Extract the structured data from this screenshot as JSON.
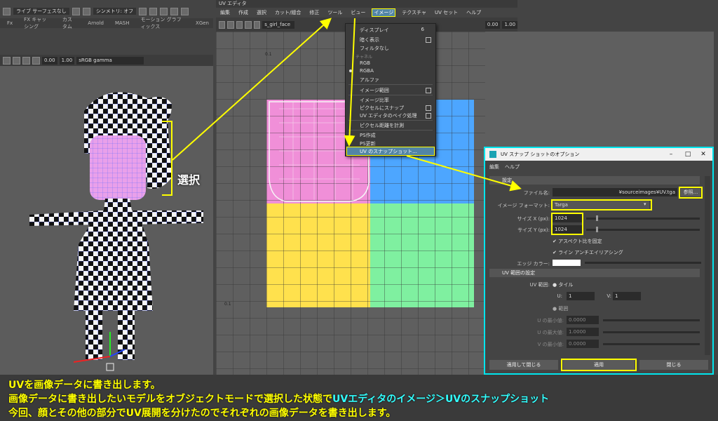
{
  "left_toolbar": {
    "shading": "ライブ サーフェスなし",
    "symmetry": "シンメトリ: オフ"
  },
  "shelf_tabs": [
    "Fx",
    "FX キャッシング",
    "カスタム",
    "Arnold",
    "MASH",
    "モーション グラフィックス",
    "XGen"
  ],
  "viewport_toolbar": {
    "exposure": "0.00",
    "gamma": "1.00",
    "colorspace": "sRGB gamma"
  },
  "uv_editor": {
    "title": "UV エディタ",
    "menus": [
      "編集",
      "作成",
      "選択",
      "カット/縫合",
      "修正",
      "ツール",
      "ビュー",
      "イメージ",
      "テクスチャ",
      "UV セット",
      "ヘルプ"
    ],
    "active_menu": "イメージ",
    "texture_name": "s_girl_face",
    "field_a": "0.00",
    "field_b": "1.00",
    "axis_ticks": [
      "0.1",
      "0.1"
    ]
  },
  "image_menu": {
    "display": "ディスプレイ",
    "display_count": "6",
    "darken": "暗く表示",
    "no_filter": "フィルタなし",
    "channels_section": "チャネル",
    "rgb": "RGB",
    "rgba": "RGBA",
    "alpha": "アルファ",
    "image_range": "イメージ範囲",
    "image_ratio": "イメージ比率",
    "pixel_snap": "ピクセルにスナップ",
    "bake": "UV エディタのベイク処理",
    "pixel_distance": "ピクセル距離を計測",
    "ps_create": "PS作成",
    "ps_update": "PS更新",
    "uv_snapshot": "UV のスナップショット..."
  },
  "dialog": {
    "title": "UV スナップ ショットのオプション",
    "menus": [
      "編集",
      "ヘルプ"
    ],
    "settings_section": "設定",
    "filename_label": "ファイル名:",
    "filename_value": "¥sourceimages¥UV.tga",
    "browse_button": "参照...",
    "format_label": "イメージ フォーマット:",
    "format_value": "Targa",
    "size_x_label": "サイズ X (px):",
    "size_x_value": "1024",
    "size_y_label": "サイズ Y (px):",
    "size_y_value": "1024",
    "keep_aspect": "アスペクト比を固定",
    "antialias": "ライン アンチエイリアシング",
    "edge_color_label": "エッジ カラー:",
    "uv_range_section": "UV 範囲の設定",
    "uv_range_label": "UV 範囲:",
    "tile_option": "タイル",
    "u_label": "U:",
    "u_value": "1",
    "v_label": "V:",
    "v_value": "1",
    "range_option": "範囲",
    "u_min_label": "U の最小値:",
    "u_min_value": "0.0000",
    "u_max_label": "U の最大値:",
    "u_max_value": "1.0000",
    "v_min_label": "V の最小値:",
    "v_min_value": "0.0000",
    "apply_close_button": "適用して閉じる",
    "apply_button": "適用",
    "close_button": "閉じる"
  },
  "annotation": {
    "select_label": "選択"
  },
  "caption": {
    "line1": "UVを画像データに書き出します。",
    "line2_a": "画像データに書き出したいモデルをオブジェクトモードで選択した状態で",
    "line2_b": "UVエディタのイメージ＞UVのスナップショット",
    "line3": "今回、顔とその他の部分でUV展開を分けたのでそれぞれの画像データを書き出します。"
  },
  "colors": {
    "highlight": "#ffff00",
    "dialog_border": "#00e5ee",
    "uv_pink": "#f08fd8",
    "uv_blue": "#4da6ff",
    "uv_yellow": "#ffe14d",
    "uv_green": "#7ff0a0"
  }
}
